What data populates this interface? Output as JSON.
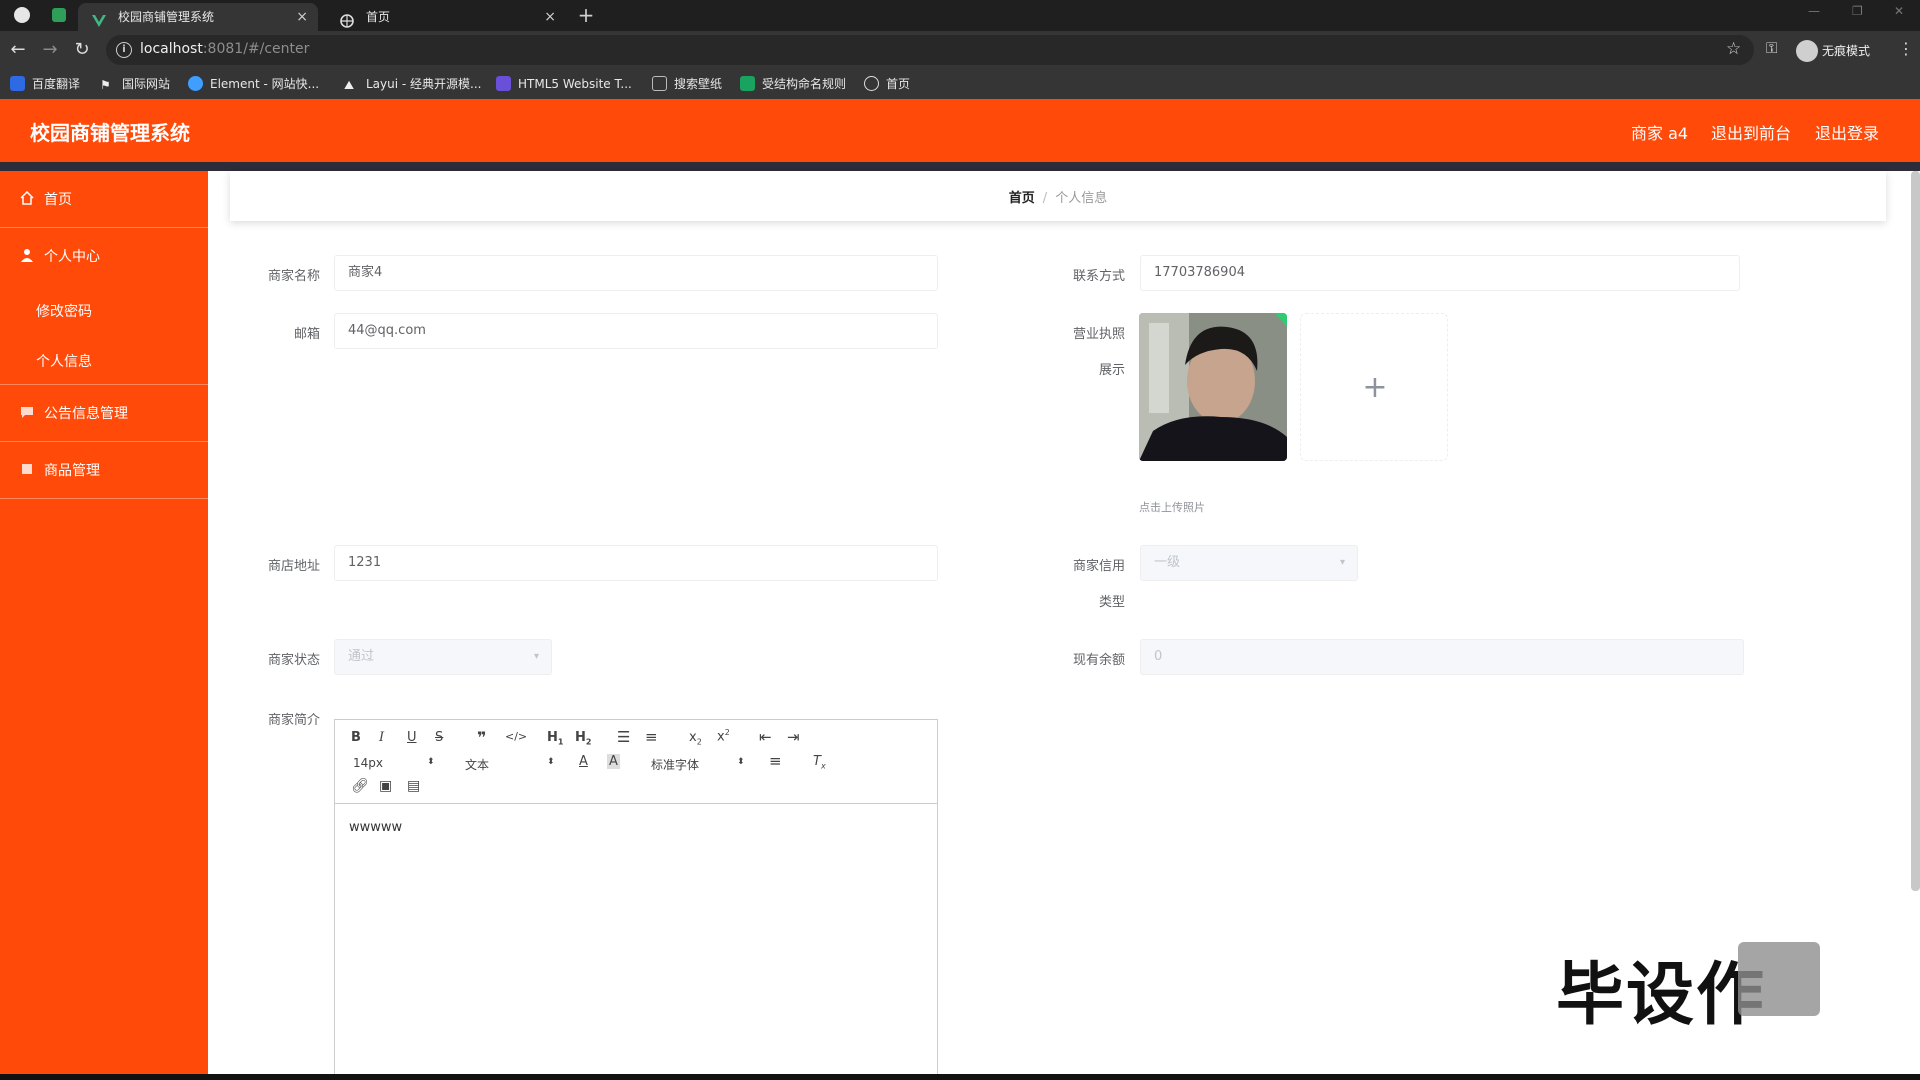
{
  "browser": {
    "tabs": [
      {
        "label": "校园商铺管理系统",
        "close": "×"
      },
      {
        "label": "首页",
        "close": "×"
      }
    ],
    "new_tab": "+",
    "url_host": "localhost",
    "url_path": ":8081/#/center",
    "incognito_label": "无痕模式",
    "bookmarks": [
      "百度翻译",
      "国际网站",
      "Element - 网站快...",
      "Layui - 经典开源模...",
      "HTML5 Website T...",
      "搜索壁纸",
      "受结构命名规则",
      "首页"
    ]
  },
  "header": {
    "title": "校园商铺管理系统",
    "user": "商家 a4",
    "back_to_front": "退出到前台",
    "logout": "退出登录"
  },
  "sidebar": {
    "home": "首页",
    "personal_center": "个人中心",
    "change_password": "修改密码",
    "personal_info": "个人信息",
    "notice_manage": "公告信息管理",
    "goods_manage": "商品管理"
  },
  "breadcrumb": {
    "home": "首页",
    "separator": "/",
    "current": "个人信息"
  },
  "form": {
    "merchant_name_label": "商家名称",
    "merchant_name_value": "商家4",
    "contact_label": "联系方式",
    "contact_value": "17703786904",
    "email_label": "邮箱",
    "email_value": "44@qq.com",
    "license_label_1": "营业执照",
    "license_label_2": "展示",
    "upload_tip": "点击上传照片",
    "upload_plus": "+",
    "address_label": "商店地址",
    "address_value": "1231",
    "credit_label_1": "商家信用",
    "credit_label_2": "类型",
    "credit_value": "一级",
    "status_label": "商家状态",
    "status_value": "通过",
    "balance_label": "现有余额",
    "balance_value": "0",
    "intro_label": "商家简介"
  },
  "editor": {
    "size_value": "14px",
    "header_value": "文本",
    "font_value": "标准字体",
    "content": "wwwww"
  },
  "watermark": "毕设作"
}
